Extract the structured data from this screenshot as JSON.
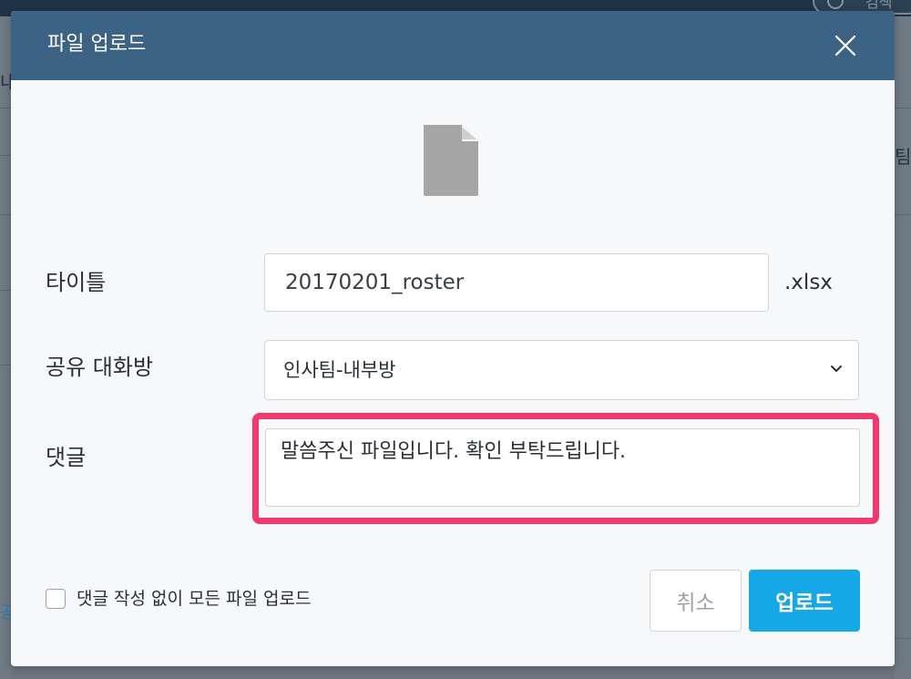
{
  "background": {
    "search_partial": "검색",
    "left_fragment": "내",
    "right_fragment": "팀",
    "left_blue_fragment": "공"
  },
  "dialog": {
    "title": "파일 업로드",
    "close_icon": "close-icon",
    "file_icon": "document-icon"
  },
  "form": {
    "title_label": "타이틀",
    "title_value": "20170201_roster",
    "extension": ".xlsx",
    "room_label": "공유 대화방",
    "room_value": "인사팀-내부방",
    "comment_label": "댓글",
    "comment_value": "말씀주신 파일입니다. 확인 부탁드립니다."
  },
  "footer": {
    "skip_label": "댓글 작성 없이 모든 파일 업로드",
    "skip_checked": false,
    "cancel_label": "취소",
    "upload_label": "업로드"
  },
  "colors": {
    "header": "#3c6383",
    "upload_button": "#16a8e6",
    "highlight": "#f2386d",
    "overlay": "#6b7680"
  }
}
